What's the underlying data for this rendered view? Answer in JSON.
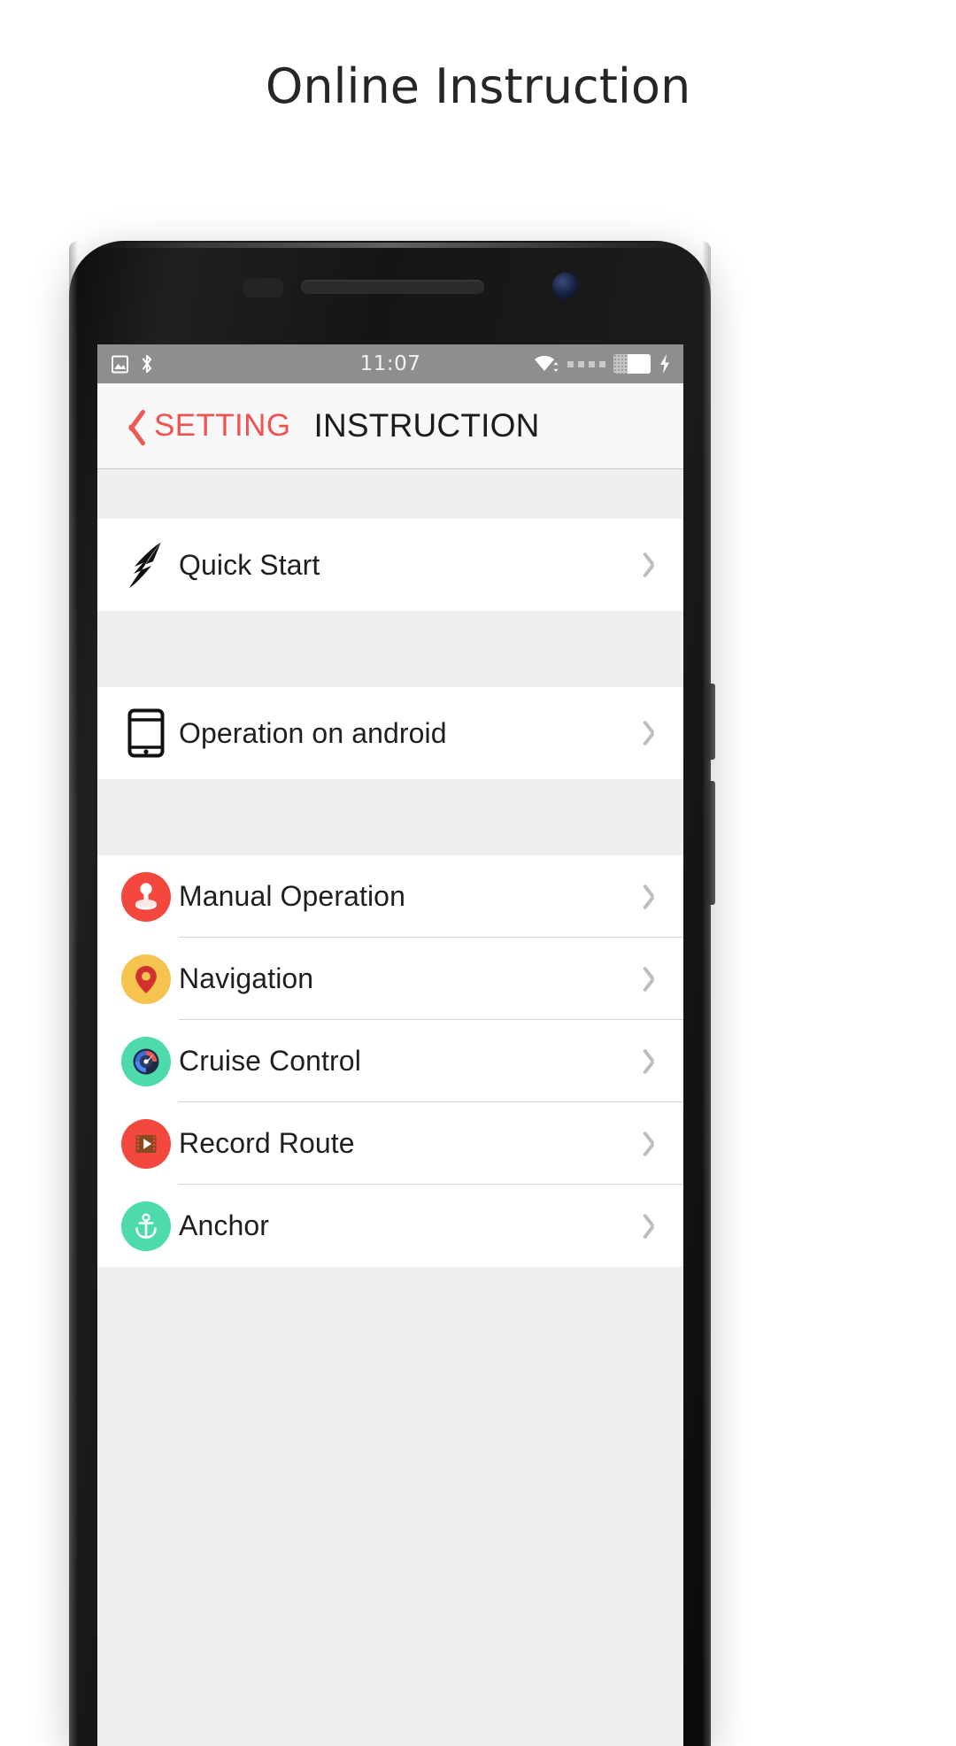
{
  "page": {
    "title": "Online Instruction"
  },
  "device": {
    "status_bar": {
      "time": "11:07",
      "left_icons": [
        "image-icon",
        "bluetooth-icon"
      ],
      "right_icons": [
        "wifi-icon",
        "signal-dots-icon",
        "battery-icon",
        "charging-bolt-icon"
      ],
      "background_color": "#8e8e8e"
    },
    "nav_bar": {
      "back_label": "SETTING",
      "back_icon": "chevron-left-icon",
      "title": "INSTRUCTION",
      "accent_color": "#ef5350",
      "title_color": "#1c1c1c"
    },
    "sections": [
      {
        "name": "quick-start-section",
        "rows": [
          {
            "label": "Quick Start",
            "icon": "lightning-bolt-icon",
            "chevron": "chevron-right-icon",
            "icon_color": "#121212"
          }
        ]
      },
      {
        "name": "platform-section",
        "rows": [
          {
            "label": "Operation on android",
            "icon": "tablet-icon",
            "chevron": "chevron-right-icon",
            "icon_color": "#121212"
          }
        ]
      },
      {
        "name": "features-section",
        "rows": [
          {
            "label": "Manual Operation",
            "icon": "joystick-icon",
            "chevron": "chevron-right-icon",
            "icon_color": "#f44336"
          },
          {
            "label": "Navigation",
            "icon": "map-pin-icon",
            "chevron": "chevron-right-icon",
            "icon_color": "#f6c04a"
          },
          {
            "label": "Cruise Control",
            "icon": "speedometer-icon",
            "chevron": "chevron-right-icon",
            "icon_color": "#4ddbad"
          },
          {
            "label": "Record Route",
            "icon": "film-play-icon",
            "chevron": "chevron-right-icon",
            "icon_color": "#f44336"
          },
          {
            "label": "Anchor",
            "icon": "anchor-icon",
            "chevron": "chevron-right-icon",
            "icon_color": "#4ddbad"
          }
        ]
      }
    ]
  }
}
